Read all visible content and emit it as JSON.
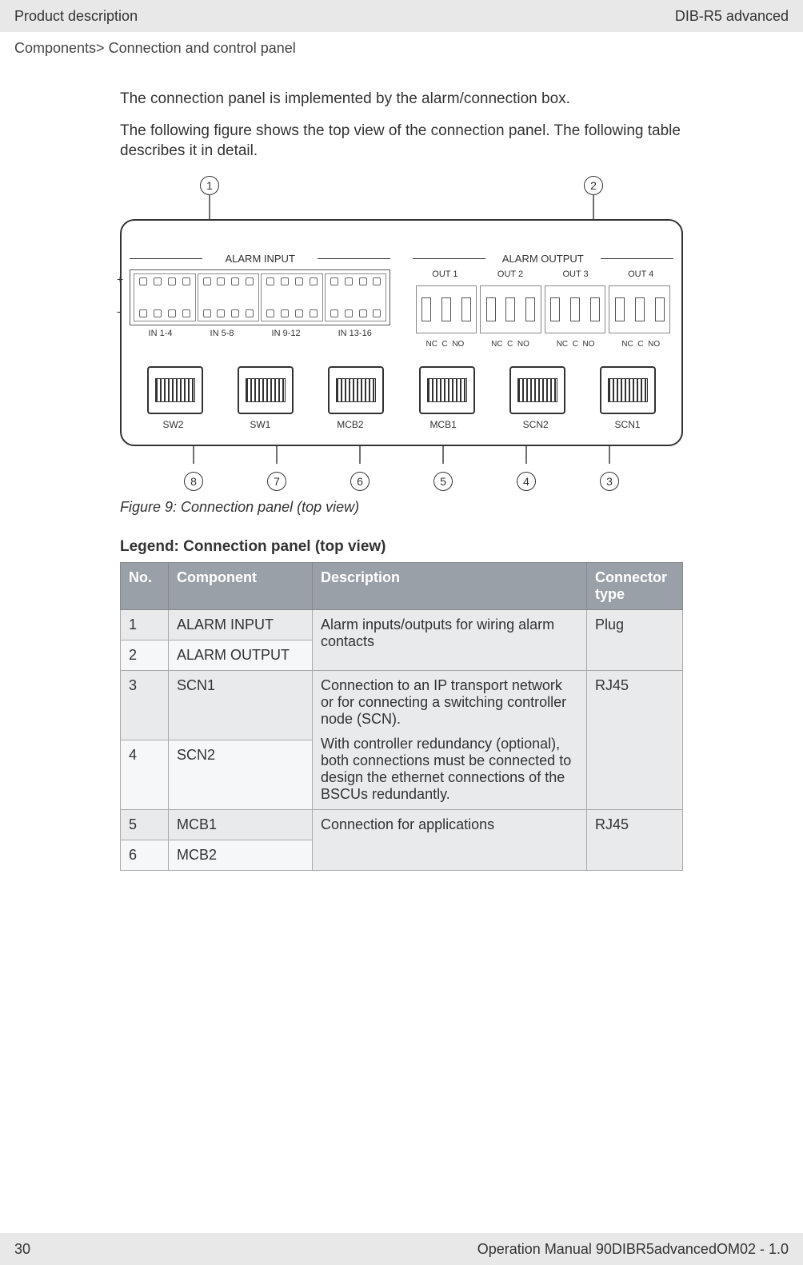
{
  "header": {
    "left": "Product description",
    "right": "DIB-R5 advanced"
  },
  "breadcrumb": "Components> Connection and control panel",
  "paragraphs": {
    "p1": "The connection panel is implemented by the alarm/connection box.",
    "p2": "The following figure shows the top view of the connection panel. The following table describes it in detail."
  },
  "figure": {
    "callout_top": [
      "1",
      "2"
    ],
    "callout_bot": [
      "8",
      "7",
      "6",
      "5",
      "4",
      "3"
    ],
    "alarm_input_title": "ALARM INPUT",
    "alarm_output_title": "ALARM OUTPUT",
    "plus": "+",
    "minus": "-",
    "in_labels": [
      "IN 1-4",
      "IN 5-8",
      "IN 9-12",
      "IN 13-16"
    ],
    "out_top": [
      "OUT 1",
      "OUT 2",
      "OUT 3",
      "OUT 4"
    ],
    "out_sub_item": [
      "NC",
      "C",
      "NO"
    ],
    "rj45_labels": [
      "SW2",
      "SW1",
      "MCB2",
      "MCB1",
      "SCN2",
      "SCN1"
    ],
    "caption": "Figure 9: Connection panel (top view)"
  },
  "legend_title": "Legend: Connection panel (top view)",
  "table_headers": {
    "no": "No.",
    "component": "Component",
    "description": "Description",
    "connector": "Connector type"
  },
  "table_rows": [
    {
      "no": "1",
      "component": "ALARM INPUT"
    },
    {
      "no": "2",
      "component": "ALARM OUTPUT"
    },
    {
      "no": "3",
      "component": "SCN1"
    },
    {
      "no": "4",
      "component": "SCN2"
    },
    {
      "no": "5",
      "component": "MCB1"
    },
    {
      "no": "6",
      "component": "MCB2"
    }
  ],
  "table_desc": {
    "alarm": "Alarm inputs/outputs for wiring alarm contacts",
    "scn_p1": "Connection to an IP transport net­work or for connecting a switching controller node (SCN).",
    "scn_p2": "With controller redundancy (optional), both connections must be connected to design the ethernet connections of the BSCUs redundantly.",
    "mcb": "Connection for applications"
  },
  "table_connector": {
    "plug": "Plug",
    "rj45": "RJ45"
  },
  "footer": {
    "left": "30",
    "right": "Operation Manual 90DIBR5advancedOM02 - 1.0"
  }
}
